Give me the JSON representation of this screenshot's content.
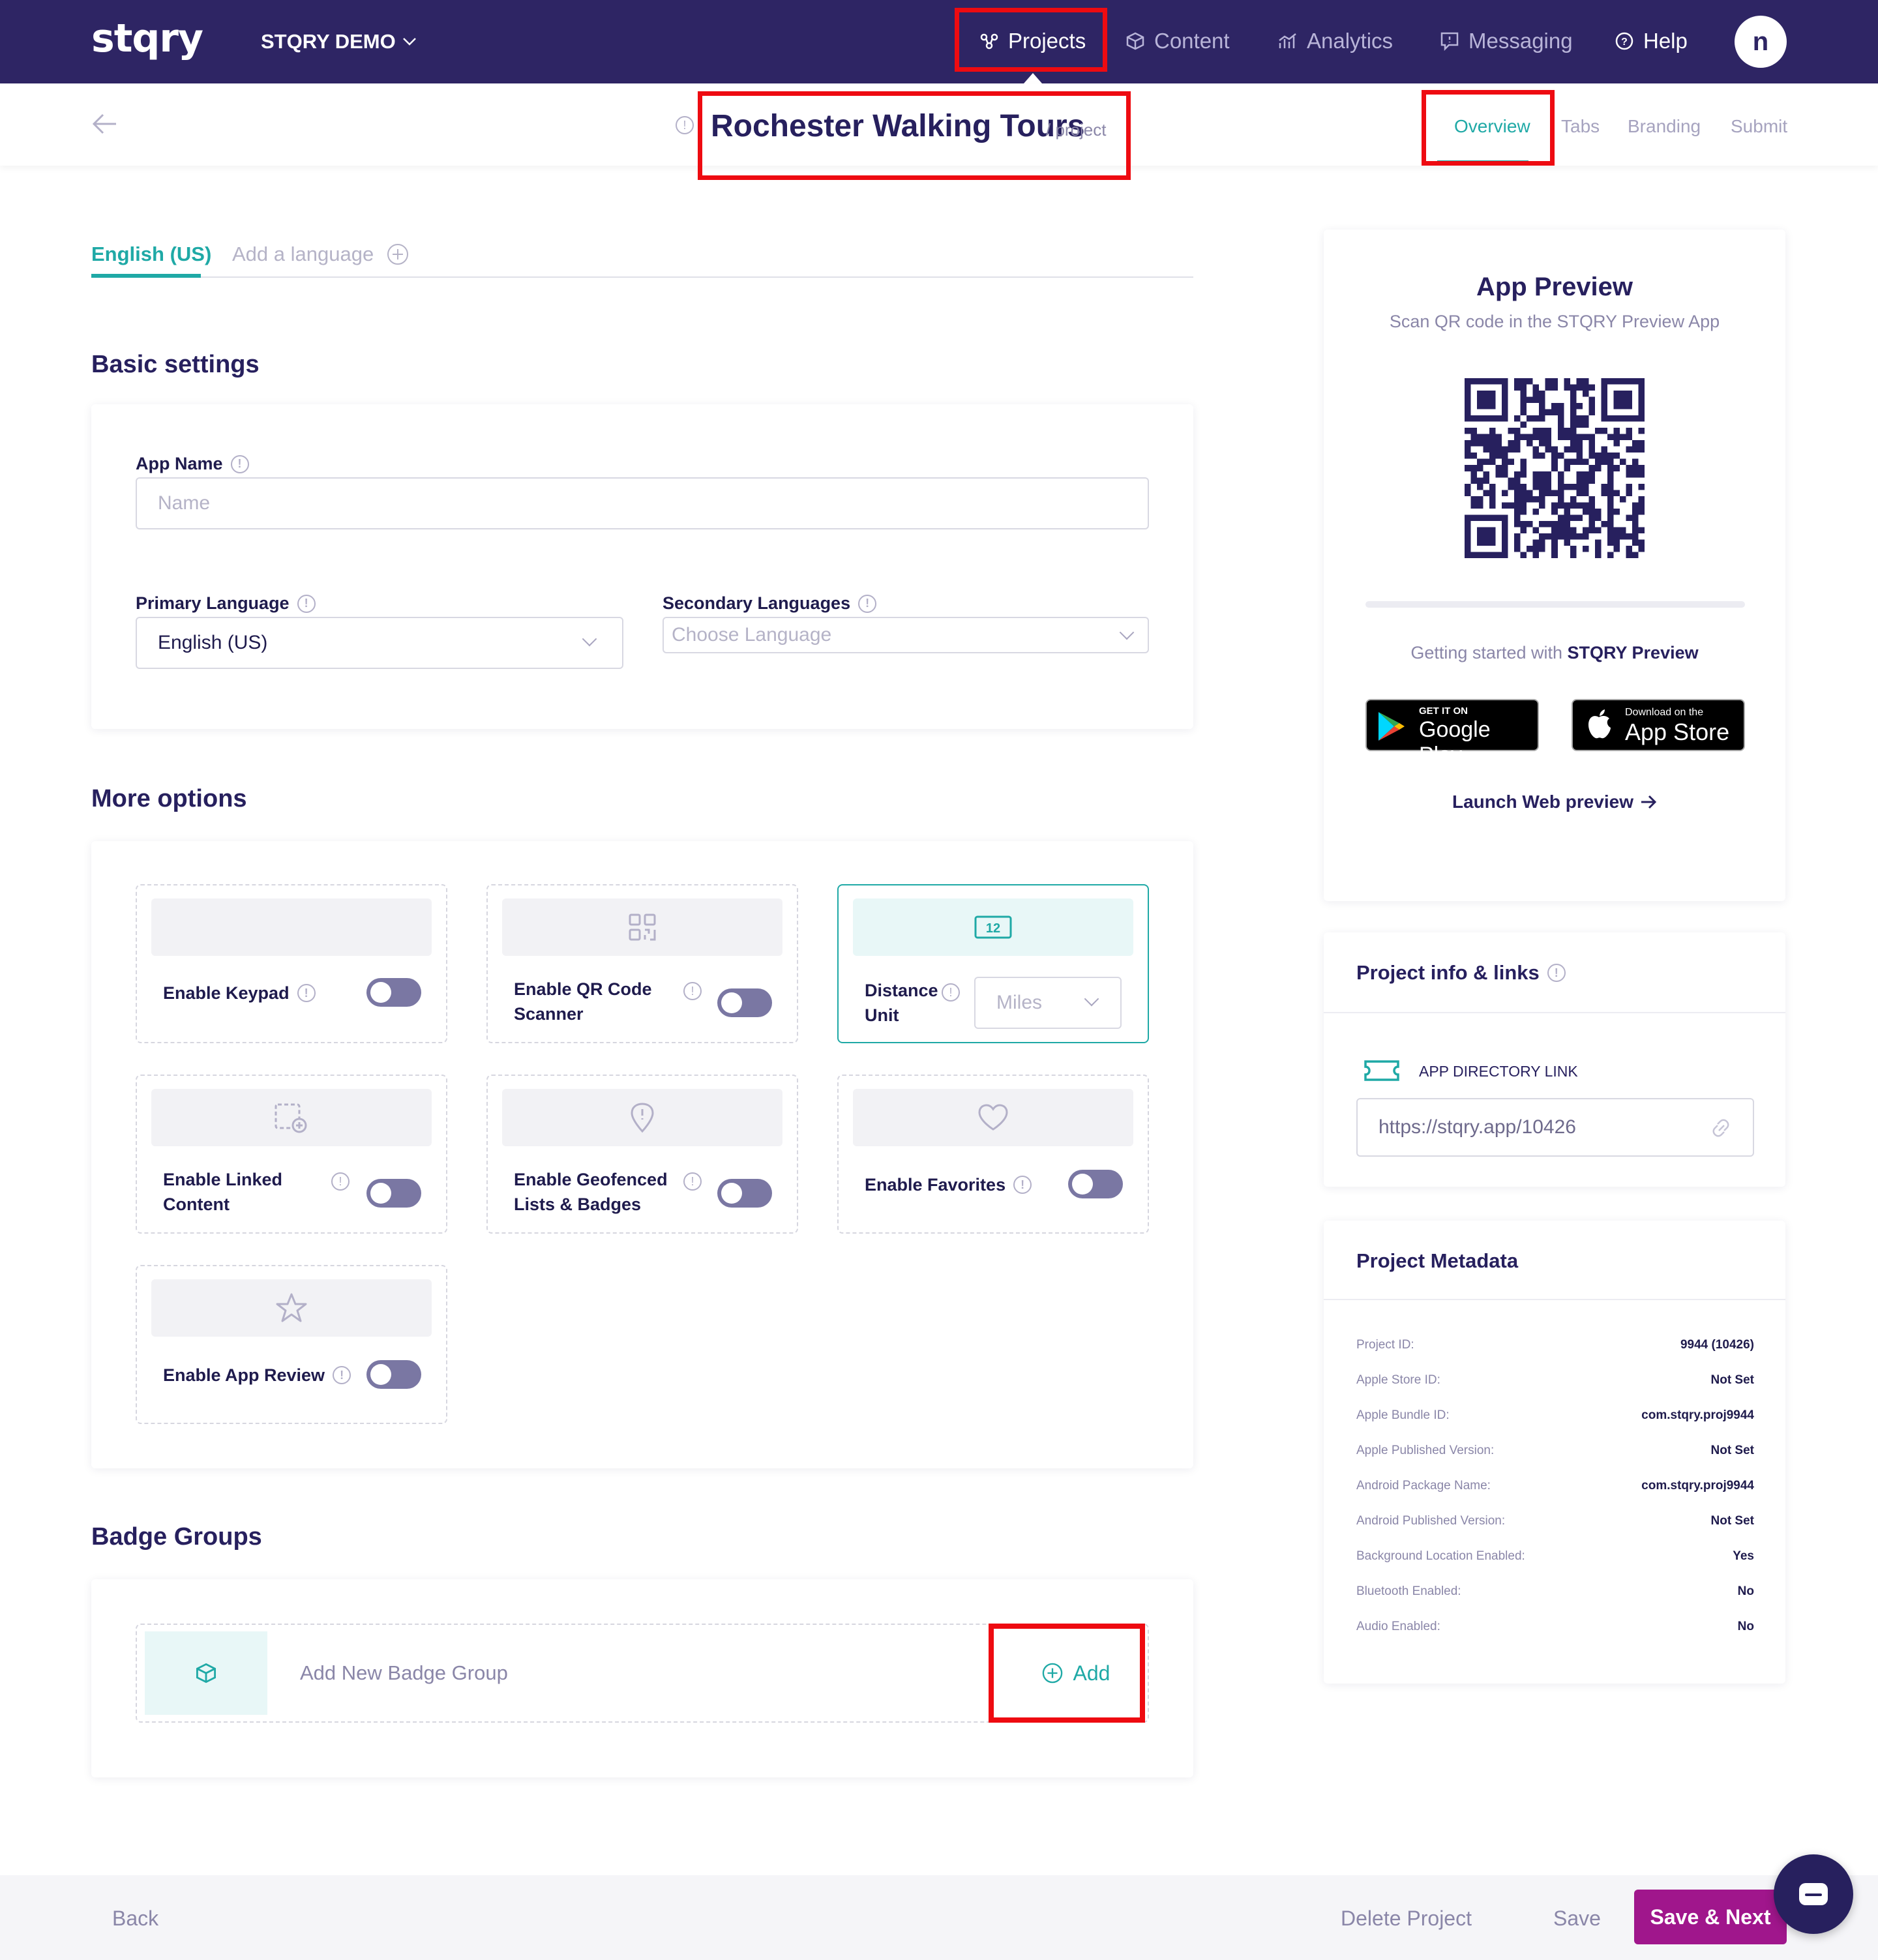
{
  "nav": {
    "logo": "stqry",
    "org_name": "STQRY DEMO",
    "items": [
      {
        "label": "Projects",
        "icon": "projects-icon"
      },
      {
        "label": "Content",
        "icon": "cube-icon"
      },
      {
        "label": "Analytics",
        "icon": "analytics-icon"
      },
      {
        "label": "Messaging",
        "icon": "messaging-icon"
      },
      {
        "label": "Help",
        "icon": "help-icon"
      }
    ],
    "avatar_initial": "n"
  },
  "header": {
    "title": "Rochester Walking Tours",
    "title_suffix": "/ project",
    "tabs": [
      "Overview",
      "Tabs",
      "Branding",
      "Submit"
    ],
    "active_tab": "Overview"
  },
  "languages": {
    "active": "English (US)",
    "add_label": "Add a language"
  },
  "basic_settings": {
    "title": "Basic settings",
    "app_name_label": "App Name",
    "app_name_placeholder": "Name",
    "primary_language_label": "Primary Language",
    "primary_language_value": "English (US)",
    "secondary_languages_label": "Secondary Languages",
    "secondary_languages_placeholder": "Choose Language"
  },
  "more_options": {
    "title": "More options",
    "tiles": [
      {
        "label": "Enable Keypad",
        "icon": "",
        "enabled": false
      },
      {
        "label_line1": "Enable QR Code",
        "label_line2": "Scanner",
        "icon": "qr-icon",
        "enabled": false
      },
      {
        "label_line1": "Distance",
        "label_line2": "Unit",
        "icon": "ruler-icon",
        "value": "Miles"
      },
      {
        "label_line1": "Enable Linked",
        "label_line2": "Content",
        "icon": "linked-content-icon",
        "enabled": false
      },
      {
        "label_line1": "Enable Geofenced",
        "label_line2": "Lists & Badges",
        "icon": "geofence-icon",
        "enabled": false
      },
      {
        "label": "Enable Favorites",
        "icon": "heart-icon",
        "enabled": false
      },
      {
        "label": "Enable App Review",
        "icon": "star-icon",
        "enabled": false
      }
    ]
  },
  "badge_groups": {
    "title": "Badge Groups",
    "add_text": "Add New Badge Group",
    "add_button": "Add"
  },
  "app_preview": {
    "title": "App Preview",
    "subtitle": "Scan QR code in the STQRY Preview App",
    "getting_started": "Getting started with",
    "getting_started_bold": "STQRY Preview",
    "google_small": "GET IT ON",
    "google_big": "Google Play",
    "apple_small": "Download on the",
    "apple_big": "App Store",
    "launch_web": "Launch Web preview"
  },
  "project_info": {
    "title": "Project info & links",
    "link_label": "APP DIRECTORY LINK",
    "link_value": "https://stqry.app/10426"
  },
  "metadata": {
    "title": "Project Metadata",
    "rows": [
      {
        "label": "Project ID:",
        "value": "9944 (10426)"
      },
      {
        "label": "Apple Store ID:",
        "value": "Not Set"
      },
      {
        "label": "Apple Bundle ID:",
        "value": "com.stqry.proj9944"
      },
      {
        "label": "Apple Published Version:",
        "value": "Not Set"
      },
      {
        "label": "Android Package Name:",
        "value": "com.stqry.proj9944"
      },
      {
        "label": "Android Published Version:",
        "value": "Not Set"
      },
      {
        "label": "Background Location Enabled:",
        "value": "Yes"
      },
      {
        "label": "Bluetooth Enabled:",
        "value": "No"
      },
      {
        "label": "Audio Enabled:",
        "value": "No"
      }
    ]
  },
  "footer": {
    "back": "Back",
    "delete": "Delete Project",
    "save": "Save",
    "save_next": "Save & Next"
  },
  "colors": {
    "nav_bg": "#2e2564",
    "accent_teal": "#1fa9a6",
    "primary_purple": "#a0168c",
    "highlight_red": "#ee0b11"
  }
}
